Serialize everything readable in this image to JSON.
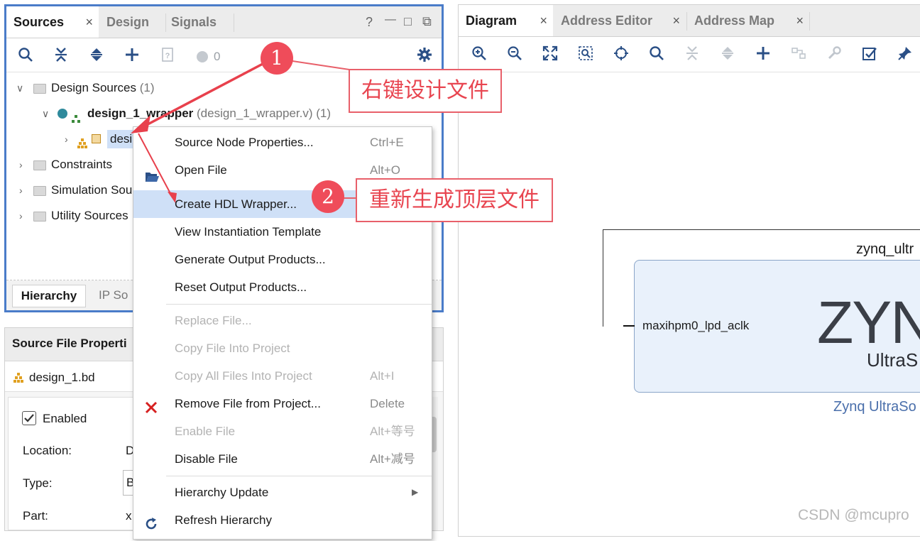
{
  "sources_panel": {
    "tabs": [
      {
        "label": "Sources",
        "close": "×"
      },
      {
        "label": "Design"
      },
      {
        "label": "Signals"
      }
    ],
    "window_controls": {
      "help": "?",
      "minimize": "—",
      "restore": "□",
      "float": "⧉"
    },
    "toolbar": {
      "messages_count": "0"
    },
    "tree": {
      "design_sources": {
        "label": "Design Sources",
        "count": "(1)"
      },
      "wrapper": {
        "label": "design_1_wrapper",
        "detail": "(design_1_wrapper.v)",
        "count": "(1)"
      },
      "child": {
        "label": "desi"
      },
      "constraints": {
        "label": "Constraints"
      },
      "simulation": {
        "label": "Simulation Sou"
      },
      "utility": {
        "label": "Utility Sources"
      }
    },
    "bottom_tabs": [
      {
        "label": "Hierarchy"
      },
      {
        "label": "IP So"
      }
    ]
  },
  "properties_panel": {
    "title": "Source File Properti",
    "file": "design_1.bd",
    "enabled_label": "Enabled",
    "fields": [
      {
        "label": "Location:",
        "value": "D"
      },
      {
        "label": "Type:",
        "value": "B"
      },
      {
        "label": "Part:",
        "value": "x"
      }
    ]
  },
  "context_menu": {
    "items": [
      {
        "label": "Source Node Properties...",
        "accel": "Ctrl+E",
        "enabled": true
      },
      {
        "label": "Open File",
        "accel": "Alt+O",
        "enabled": true
      },
      {
        "label": "Create HDL Wrapper...",
        "accel": "",
        "enabled": true,
        "highlighted": true
      },
      {
        "label": "View Instantiation Template",
        "accel": "",
        "enabled": true
      },
      {
        "label": "Generate Output Products...",
        "accel": "",
        "enabled": true
      },
      {
        "label": "Reset Output Products...",
        "accel": "",
        "enabled": true
      },
      {
        "label": "Replace File...",
        "accel": "",
        "enabled": false
      },
      {
        "label": "Copy File Into Project",
        "accel": "",
        "enabled": false
      },
      {
        "label": "Copy All Files Into Project",
        "accel": "Alt+I",
        "enabled": false
      },
      {
        "label": "Remove File from Project...",
        "accel": "Delete",
        "enabled": true
      },
      {
        "label": "Enable File",
        "accel": "Alt+等号",
        "enabled": false
      },
      {
        "label": "Disable File",
        "accel": "Alt+减号",
        "enabled": true
      },
      {
        "label": "Hierarchy Update",
        "accel": "",
        "enabled": true,
        "submenu": true
      },
      {
        "label": "Refresh Hierarchy",
        "accel": "",
        "enabled": true
      }
    ]
  },
  "diagram_panel": {
    "tabs": [
      {
        "label": "Diagram",
        "close": "×"
      },
      {
        "label": "Address Editor",
        "close": "×"
      },
      {
        "label": "Address Map",
        "close": "×"
      }
    ],
    "block": {
      "instance_name": "zynq_ultr",
      "port": "maxihpm0_lpd_aclk",
      "logo": "ZYN",
      "logo_sub": "UltraS",
      "caption": "Zynq UltraSo"
    }
  },
  "annotations": {
    "step1": {
      "number": "1",
      "text": "右键设计文件"
    },
    "step2": {
      "number": "2",
      "text": "重新生成顶层文件"
    },
    "arrow_color": "#e8404c"
  },
  "watermark": "CSDN @mcupro"
}
